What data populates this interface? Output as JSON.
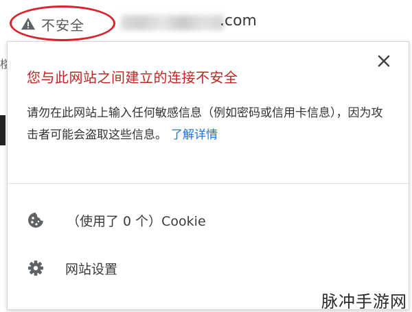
{
  "omnibox": {
    "security_label": "不安全",
    "url_suffix": ".com"
  },
  "page_behind": {
    "edge_text": "楼"
  },
  "bubble": {
    "title": "您与此网站之间建立的连接不安全",
    "description": "请勿在此网站上输入任何敏感信息（例如密码或信用卡信息），因为攻击者可能会盗取这些信息。",
    "learn_more": "了解详情",
    "cookies_label": "（使用了 0 个）Cookie",
    "site_settings_label": "网站设置"
  },
  "watermark": "脉冲手游网",
  "colors": {
    "warning_red": "#c5221f",
    "highlight_circle": "#d9232e",
    "link_blue": "#1a73e8"
  },
  "icons": {
    "security": "warning-triangle-icon",
    "close": "close-icon",
    "cookies": "cookie-icon",
    "settings": "gear-icon"
  }
}
